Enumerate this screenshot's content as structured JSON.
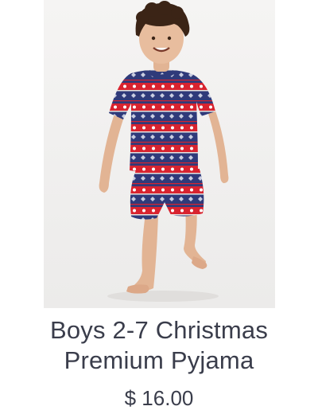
{
  "product": {
    "image_alt": "Boy wearing navy and red Christmas fair isle short pyjamas",
    "name_line1": "Boys 2-7 Christmas",
    "name_line2": "Premium Pyjama",
    "price": "$ 16.00"
  },
  "colors": {
    "text": "#3a3d4b",
    "navy": "#2f3a7a",
    "red": "#d8232f",
    "photo_bg": "#f1efee"
  }
}
